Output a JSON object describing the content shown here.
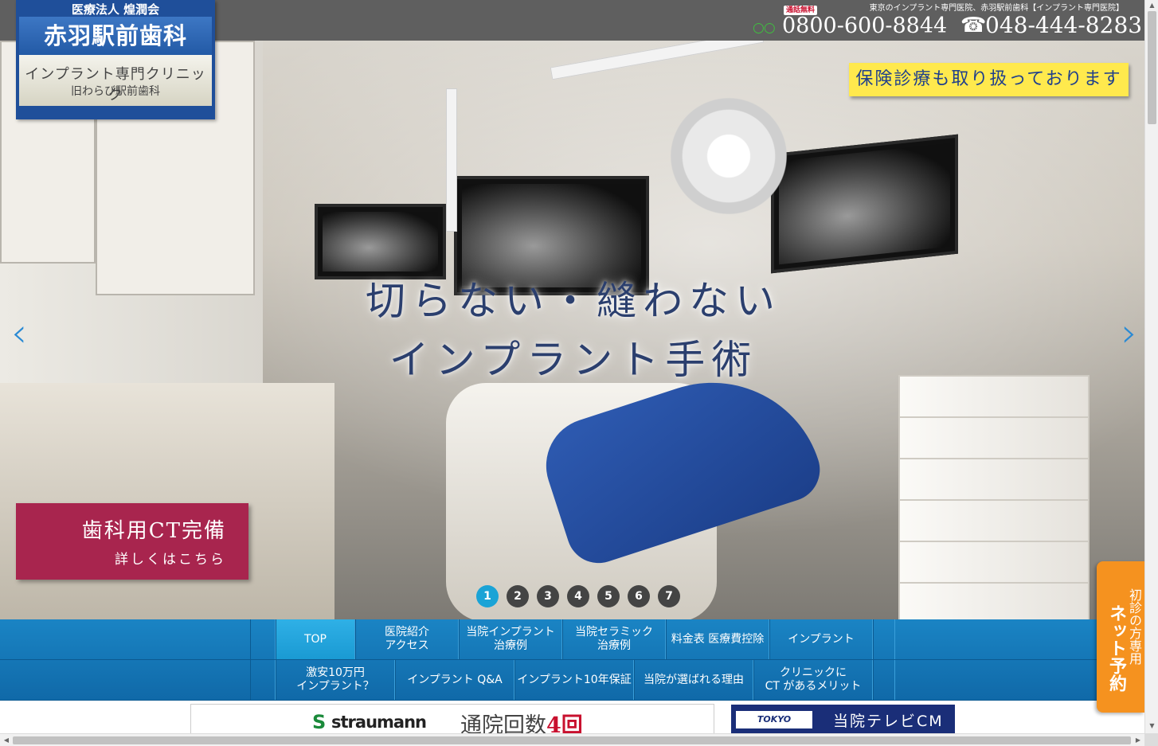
{
  "header": {
    "tagline": "東京のインプラント専門医院、赤羽駅前歯科【インプラント専門医院】",
    "free_call_badge": "通話無料",
    "freedial_icon": "freedial-icon",
    "phone_free": "0800-600-8844",
    "phone_icon": "phone-icon",
    "phone_main": "048-444-8283"
  },
  "logo": {
    "org": "医療法人 煌潤会",
    "name": "赤羽駅前歯科",
    "sub": "インプラント専門クリニック",
    "old_name": "旧わらび駅前歯科"
  },
  "hero": {
    "title_line1": "切らない・縫わない",
    "title_line2": "インプラント手術",
    "insurance": "保険診療も取り扱っております",
    "ct_title": "歯科用CT完備",
    "ct_sub": "詳しくはこちら",
    "prev_arrow": "‹",
    "next_arrow": "›",
    "slides": [
      "1",
      "2",
      "3",
      "4",
      "5",
      "6",
      "7"
    ],
    "active_slide": "1"
  },
  "nav": {
    "row1": [
      "TOP",
      "医院紹介\nアクセス",
      "当院インプラント\n治療例",
      "当院セラミック\n治療例",
      "料金表 医療費控除",
      "インプラント"
    ],
    "row2": [
      "激安10万円\nインプラント？",
      "インプラント Q&A",
      "インプラント10年保証",
      "当院が選ばれる理由",
      "クリニックに\nCT があるメリット"
    ]
  },
  "banners": {
    "straumann_brand": "straumann",
    "straumann_text_a": "通院回数",
    "straumann_text_b": "4回",
    "tv_logo": "TOKYO",
    "tv_text": "当院テレビCM"
  },
  "reserve": {
    "line1": "初診の方専用",
    "line2": "ネット予約"
  },
  "colors": {
    "nav_blue": "#1a84c4",
    "nav_active": "#1aa3d6",
    "ct_box": "#a8254e",
    "insurance_bg": "#ffe94d",
    "reserve_orange": "#f5921f",
    "logo_blue": "#1f4f9a"
  }
}
